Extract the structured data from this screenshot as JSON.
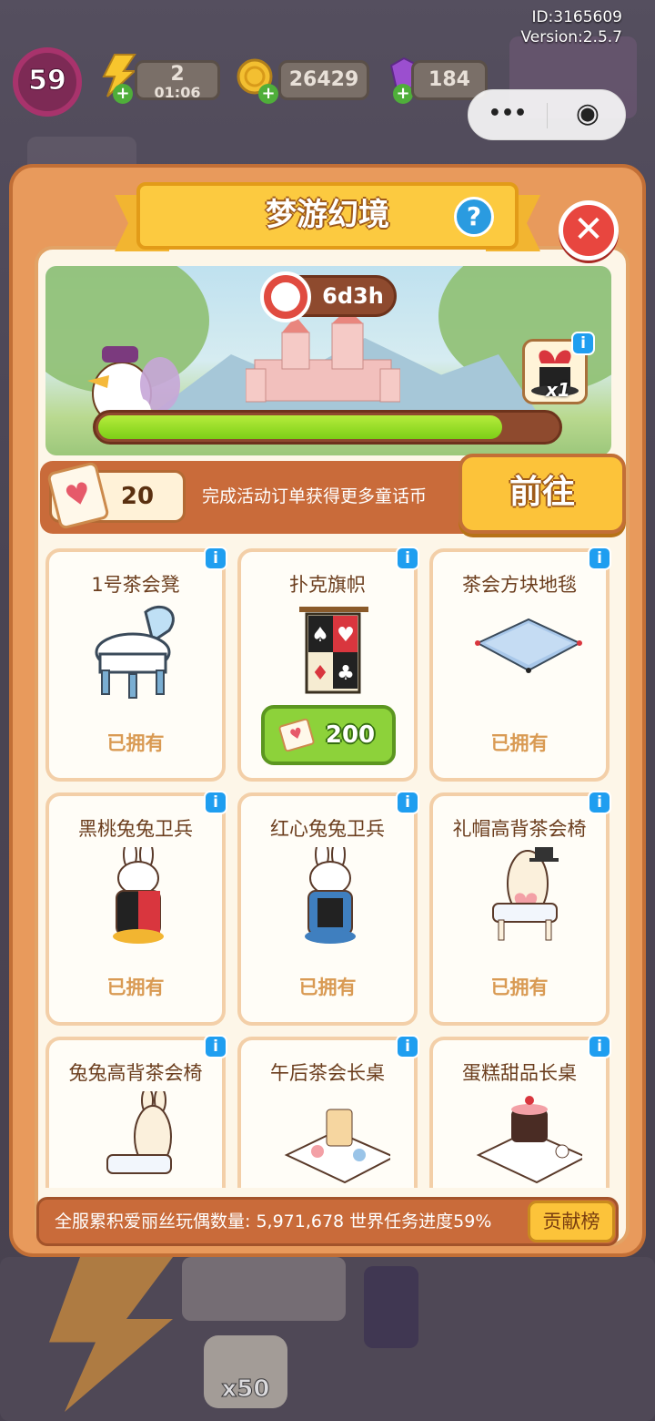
{
  "hud": {
    "id_text": "ID:3165609",
    "version_text": "Version:2.5.7",
    "level": "59",
    "energy": {
      "value": "2",
      "timer": "01:06"
    },
    "coins": "26429",
    "gems": "184",
    "capsule": {
      "more": "•••",
      "close": "◉"
    }
  },
  "panel": {
    "title": "梦游幻境",
    "help_label": "?",
    "close_label": "✕",
    "timer": "6d3h",
    "progress_fraction": 0.88,
    "reward_qty": "x1"
  },
  "currency": {
    "amount": "20",
    "tip": "完成活动订单获得更多童话币",
    "goto_label": "前往"
  },
  "items": [
    {
      "name": "1号茶会凳",
      "status": "已拥有"
    },
    {
      "name": "扑克旗帜",
      "price": "200"
    },
    {
      "name": "茶会方块地毯",
      "status": "已拥有"
    },
    {
      "name": "黑桃兔兔卫兵",
      "status": "已拥有"
    },
    {
      "name": "红心兔兔卫兵",
      "status": "已拥有"
    },
    {
      "name": "礼帽高背茶会椅",
      "status": "已拥有"
    },
    {
      "name": "兔兔高背茶会椅"
    },
    {
      "name": "午后茶会长桌"
    },
    {
      "name": "蛋糕甜品长桌"
    }
  ],
  "info_label": "i",
  "world": {
    "text": "全服累积爱丽丝玩偶数量: 5,971,678  世界任务进度59%",
    "rank_label": "贡献榜"
  },
  "bottom": {
    "count": "x50"
  },
  "colors": {
    "panel_orange": "#e89a5c",
    "title_yellow": "#fcca40",
    "progress_green": "#7ccf17",
    "buy_green": "#8dd23a",
    "close_red": "#e8463f",
    "owned_text": "#d99a53"
  }
}
